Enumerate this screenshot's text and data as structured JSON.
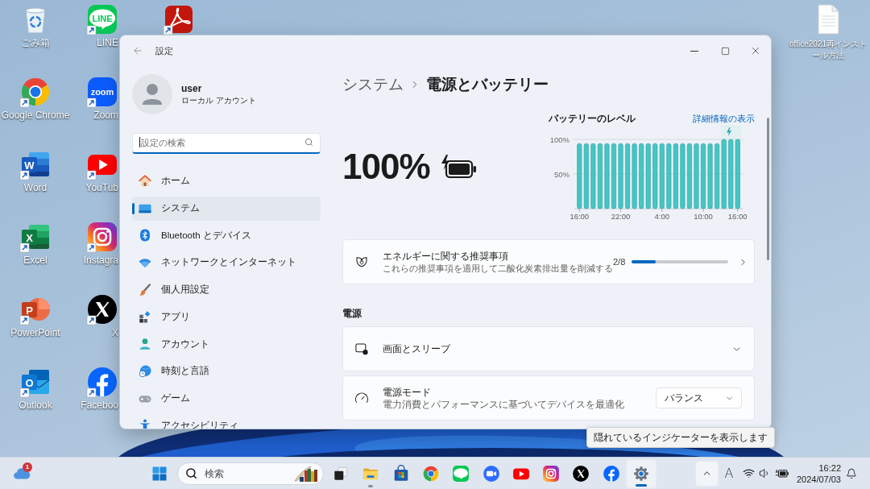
{
  "desktop": {
    "shortcuts": [
      {
        "kind": "recycle_bin",
        "label": "ごみ箱",
        "shortcut": false
      },
      {
        "kind": "chrome",
        "label": "Google Chrome",
        "shortcut": true
      },
      {
        "kind": "word",
        "label": "Word",
        "logo_text": "W",
        "shortcut": true
      },
      {
        "kind": "excel",
        "label": "Excel",
        "logo_text": "X",
        "shortcut": true
      },
      {
        "kind": "powerpoint",
        "label": "PowerPoint",
        "logo_text": "P",
        "shortcut": true
      },
      {
        "kind": "outlook",
        "label": "Outlook",
        "logo_text": "O",
        "shortcut": true
      },
      {
        "kind": "line",
        "label": "LINE",
        "logo_text": "LINE",
        "shortcut": true
      },
      {
        "kind": "zoom",
        "label": "Zoom",
        "logo_text": "zoom",
        "shortcut": true
      },
      {
        "kind": "youtube",
        "label": "YouTub",
        "shortcut": true
      },
      {
        "kind": "instagram",
        "label": "Instagra",
        "shortcut": true
      },
      {
        "kind": "x",
        "label": "X",
        "shortcut": true
      },
      {
        "kind": "facebook",
        "label": "Faceboo",
        "shortcut": true
      },
      {
        "kind": "acrobat",
        "shortcut": true
      }
    ],
    "files": [
      {
        "kind": "document",
        "label": "office2021再インストール方法"
      }
    ]
  },
  "settings_window": {
    "title": "設定",
    "account": {
      "name": "user",
      "type": "ローカル アカウント"
    },
    "search": {
      "placeholder": "設定の検索",
      "focused": true
    },
    "nav": [
      {
        "kind": "home",
        "label": "ホーム",
        "selected": false
      },
      {
        "kind": "system",
        "label": "システム",
        "selected": true
      },
      {
        "kind": "bluetooth",
        "label": "Bluetooth とデバイス",
        "selected": false
      },
      {
        "kind": "network",
        "label": "ネットワークとインターネット",
        "selected": false
      },
      {
        "kind": "personalization",
        "label": "個人用設定",
        "selected": false
      },
      {
        "kind": "apps",
        "label": "アプリ",
        "selected": false
      },
      {
        "kind": "accounts",
        "label": "アカウント",
        "selected": false
      },
      {
        "kind": "time",
        "label": "時刻と言語",
        "selected": false
      },
      {
        "kind": "gaming",
        "label": "ゲーム",
        "selected": false
      },
      {
        "kind": "accessibility",
        "label": "アクセシビリティ",
        "selected": false
      }
    ],
    "breadcrumb": {
      "parent": "システム",
      "current": "電源とバッテリー"
    },
    "battery": {
      "percent": "100%",
      "charging": true
    },
    "battery_level": {
      "title": "バッテリーのレベル",
      "link": "詳細情報の表示",
      "chart_data": {
        "type": "bar",
        "categories": [
          "16:00",
          null,
          null,
          null,
          null,
          null,
          "22:00",
          null,
          null,
          null,
          null,
          null,
          "4:00",
          null,
          null,
          null,
          null,
          null,
          "10:00",
          null,
          null,
          null,
          null,
          "16:00"
        ],
        "series": [
          {
            "color": "#45c6c3",
            "values": [
              94,
              94,
              94,
              94,
              94,
              94,
              94,
              94,
              94,
              94,
              94,
              94,
              94,
              94,
              94,
              94,
              94,
              94,
              94,
              94,
              94,
              100,
              100,
              100
            ]
          }
        ],
        "ylim": [
          0,
          100
        ],
        "yticks": [
          {
            "value": 50,
            "label": "50%"
          },
          {
            "value": 100,
            "label": "100%"
          }
        ]
      }
    },
    "recommendations": {
      "title": "エネルギーに関する推奨事項",
      "subtitle": "これらの推奨事項を適用して二酸化炭素排出量を削減する",
      "count": "2/8",
      "level": 0.25
    },
    "power": {
      "heading": "電源",
      "rows": [
        {
          "kind": "screen_sleep",
          "title": "画面とスリープ",
          "expanded": false
        },
        {
          "kind": "power_mode",
          "title": "電源モード",
          "subtitle": "電力消費とパフォーマンスに基づいてデバイスを最適化",
          "value": "バランス"
        }
      ]
    }
  },
  "tooltip": {
    "text": "隠れているインジケーターを表示します"
  },
  "taskbar": {
    "widget": {
      "badge": "1"
    },
    "search": {
      "placeholder": "検索"
    },
    "apps": [
      {
        "kind": "task_view",
        "running": false,
        "active": false
      },
      {
        "kind": "explorer",
        "running": true,
        "active": false
      },
      {
        "kind": "store",
        "running": false,
        "active": false
      },
      {
        "kind": "chrome",
        "running": false,
        "active": false
      },
      {
        "kind": "line",
        "running": false,
        "active": false
      },
      {
        "kind": "zoom",
        "running": false,
        "active": false
      },
      {
        "kind": "youtube",
        "running": false,
        "active": false
      },
      {
        "kind": "instagram",
        "running": false,
        "active": false
      },
      {
        "kind": "x",
        "running": false,
        "active": false
      },
      {
        "kind": "facebook",
        "running": false,
        "active": false
      },
      {
        "kind": "settings",
        "running": true,
        "active": true
      }
    ],
    "tray": {
      "overflow_hovered": true,
      "ime": "A",
      "time": "16:22",
      "date": "2024/07/03"
    }
  }
}
